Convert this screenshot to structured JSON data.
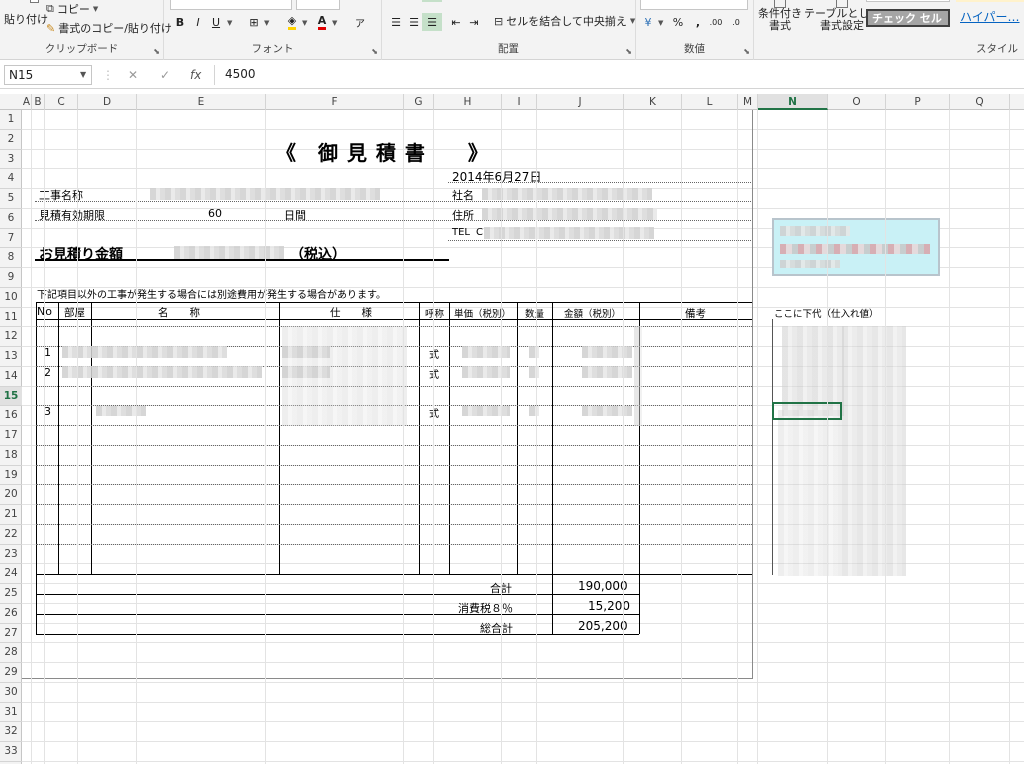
{
  "ribbon": {
    "clipboard": {
      "paste": "貼り付け",
      "copy": "コピー",
      "format_painter": "書式のコピー/貼り付け",
      "label": "クリップボード"
    },
    "font": {
      "bold": "B",
      "italic": "I",
      "underline": "U",
      "label": "フォント"
    },
    "alignment": {
      "merge": "セルを結合して中央揃え",
      "label": "配置"
    },
    "number": {
      "percent": "%",
      "comma": ",",
      "label": "数値"
    },
    "styles": {
      "cond_format": [
        "条件付き",
        "書式"
      ],
      "table_format": [
        "テーブルとして",
        "書式設定"
      ],
      "check_cell": "チェック セル",
      "hyperlink": "ハイパー…",
      "label": "スタイル"
    }
  },
  "formula_bar": {
    "name_box": "N15",
    "cancel": "✕",
    "enter": "✓",
    "fx": "fx",
    "value": "4500"
  },
  "columns": [
    "A",
    "B",
    "C",
    "D",
    "E",
    "F",
    "G",
    "H",
    "I",
    "J",
    "K",
    "L",
    "M",
    "N",
    "O",
    "P",
    "Q"
  ],
  "selected_column": "N",
  "rows": [
    "1",
    "2",
    "3",
    "4",
    "5",
    "6",
    "7",
    "8",
    "9",
    "10",
    "11",
    "12",
    "13",
    "14",
    "15",
    "16",
    "17",
    "18",
    "19",
    "20",
    "21",
    "22",
    "23",
    "24",
    "25",
    "26",
    "27",
    "28",
    "29",
    "30",
    "31",
    "32",
    "33"
  ],
  "selected_row": "15",
  "sheet": {
    "title": "《　御 見 積 書　　》",
    "date": "2014年6月27日",
    "project_label": "工事名称",
    "validity_label": "見積有効期限",
    "validity_value": "60",
    "validity_unit": "日間",
    "company_label": "社名",
    "address_label": "住所",
    "tel_label": "TEL",
    "tel_prefix": "C",
    "total_label": "お見積り金額",
    "tax_included": "（税込）",
    "notice": "下記項目以外の工事が発生する場合には別途費用が発生する場合があります。",
    "headers": {
      "no": "No",
      "room": "部屋",
      "name": "名　　称",
      "spec": "仕　　様",
      "unit": "呼称",
      "unit_price": "単価（税別）",
      "qty": "数量",
      "amount": "金額（税別）",
      "remarks": "備考"
    },
    "side_header": "ここに下代（仕入れ値）",
    "items": [
      {
        "no": "1",
        "unit": "式"
      },
      {
        "no": "2",
        "unit": "式"
      },
      {
        "no": "3",
        "unit": "式"
      }
    ],
    "subtotal_label": "合計",
    "subtotal": "190,000",
    "tax_label": "消費税８％",
    "tax": "15,200",
    "grand_total_label": "総合計",
    "grand_total": "205,200"
  }
}
